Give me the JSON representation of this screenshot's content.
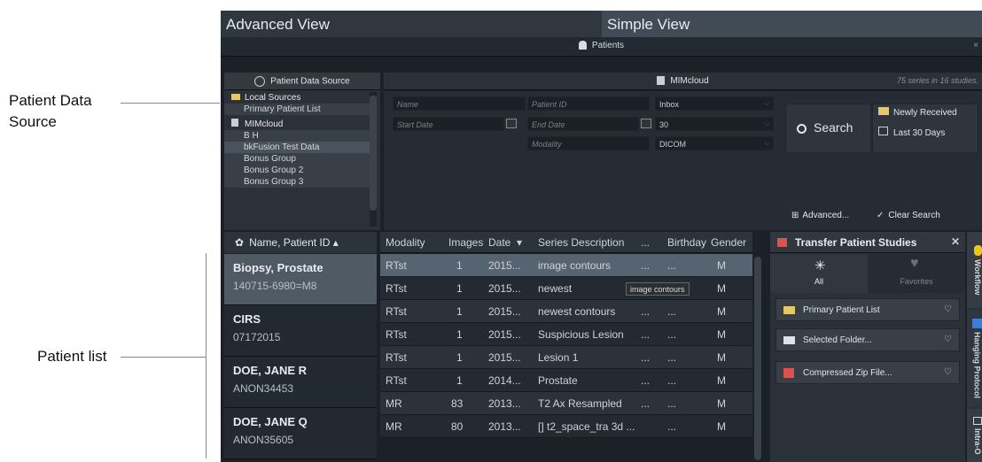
{
  "annotations": {
    "patient_data_source": [
      "Patient Data",
      "Source"
    ],
    "patient_list": "Patient list"
  },
  "tabs": {
    "advanced": "Advanced View",
    "simple": "Simple View"
  },
  "patients_bar": {
    "title": "Patients",
    "close": "×"
  },
  "patient_data_source": {
    "header": "Patient Data Source",
    "items": [
      {
        "label": "Local Sources",
        "type": "group",
        "icon": "folder-icon"
      },
      {
        "label": "Primary Patient List",
        "type": "sub"
      },
      {
        "label": "MIMcloud",
        "type": "group",
        "icon": "cloud-person-icon"
      },
      {
        "label": "B H",
        "type": "sub"
      },
      {
        "label": "bkFusion Test Data",
        "type": "selected"
      },
      {
        "label": "Bonus Group",
        "type": "sub"
      },
      {
        "label": "Bonus Group 2",
        "type": "sub"
      },
      {
        "label": "Bonus Group 3",
        "type": "sub"
      }
    ]
  },
  "mimcloud": {
    "header": "MIMcloud",
    "count": "75 series in 16 studies."
  },
  "search": {
    "name_placeholder": "Name",
    "patient_id_placeholder": "Patient ID",
    "source": "Inbox",
    "start_date_placeholder": "Start Date",
    "end_date_placeholder": "End Date",
    "days": "30",
    "modality_placeholder": "Modality",
    "format": "DICOM",
    "search_label": "Search",
    "newly_received": "Newly Received",
    "last_30_days": "Last 30 Days",
    "advanced": "Advanced...",
    "clear": "Clear Search"
  },
  "patient_list": {
    "sort_label": "Name, Patient ID",
    "patients": [
      {
        "name": "Biopsy, Prostate",
        "id": "140715-6980=M8"
      },
      {
        "name": "CIRS",
        "id": "07172015"
      },
      {
        "name": "DOE, JANE R",
        "id": "ANON34453"
      },
      {
        "name": "DOE, JANE Q",
        "id": "ANON35605"
      }
    ]
  },
  "series": {
    "columns": [
      "Modality",
      "Images",
      "Date",
      "Series Description",
      "...",
      "Birthday",
      "Gender"
    ],
    "rows": [
      {
        "modality": "RTst",
        "images": "1",
        "date": "2015...",
        "desc": "image contours",
        "dots": "...",
        "bday": "...",
        "gender": "M"
      },
      {
        "modality": "RTst",
        "images": "1",
        "date": "2015...",
        "desc": "newest",
        "dots": "",
        "bday": "",
        "gender": "M"
      },
      {
        "modality": "RTst",
        "images": "1",
        "date": "2015...",
        "desc": "newest contours",
        "dots": "...",
        "bday": "...",
        "gender": "M"
      },
      {
        "modality": "RTst",
        "images": "1",
        "date": "2015...",
        "desc": "Suspicious Lesion",
        "dots": "...",
        "bday": "...",
        "gender": "M"
      },
      {
        "modality": "RTst",
        "images": "1",
        "date": "2015...",
        "desc": "Lesion 1",
        "dots": "...",
        "bday": "...",
        "gender": "M"
      },
      {
        "modality": "RTst",
        "images": "1",
        "date": "2014...",
        "desc": "Prostate",
        "dots": "...",
        "bday": "...",
        "gender": "M"
      },
      {
        "modality": "MR",
        "images": "83",
        "date": "2013...",
        "desc": "T2 Ax Resampled",
        "dots": "...",
        "bday": "...",
        "gender": "M"
      },
      {
        "modality": "MR",
        "images": "80",
        "date": "2013...",
        "desc": "[] t2_space_tra 3d ...",
        "dots": "...",
        "bday": "",
        "gender": "M"
      }
    ],
    "tooltip": "image contours"
  },
  "transfer": {
    "header": "Transfer Patient Studies",
    "tab_all": "All",
    "tab_favorites": "Favorites",
    "items": [
      "Primary Patient List",
      "Selected Folder...",
      "Compressed Zip File..."
    ]
  },
  "side_tabs": [
    "Workflow",
    "Hanging Protocol",
    "Intra-O"
  ]
}
